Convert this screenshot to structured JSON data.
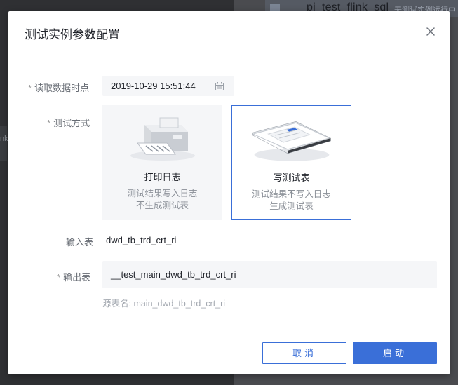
{
  "background": {
    "tab_title": "pi_test_flink_sql",
    "tab_hint": "无测试实例运行中",
    "side_fragment": "nk"
  },
  "dialog": {
    "title": "测试实例参数配置",
    "close_icon": "close-icon"
  },
  "form": {
    "read_time_label": "读取数据时点",
    "read_time_value": "2019-10-29 15:51:44",
    "test_mode_label": "测试方式",
    "modes": [
      {
        "title": "打印日志",
        "line1": "测试结果写入日志",
        "line2": "不生成测试表",
        "selected": false,
        "icon": "printer-icon"
      },
      {
        "title": "写测试表",
        "line1": "测试结果不写入日志",
        "line2": "生成测试表",
        "selected": true,
        "icon": "table-sheet-icon"
      }
    ],
    "input_table_label": "输入表",
    "input_table_value": "dwd_tb_trd_crt_ri",
    "output_table_label": "输出表",
    "output_table_value": "__test_main_dwd_tb_trd_crt_ri",
    "source_table_hint": "源表名: main_dwd_tb_trd_crt_ri",
    "required_mark": "*"
  },
  "footer": {
    "cancel_label": "取消",
    "start_label": "启动"
  },
  "colors": {
    "accent": "#3a6fd8",
    "field_bg": "#f5f6f8"
  }
}
